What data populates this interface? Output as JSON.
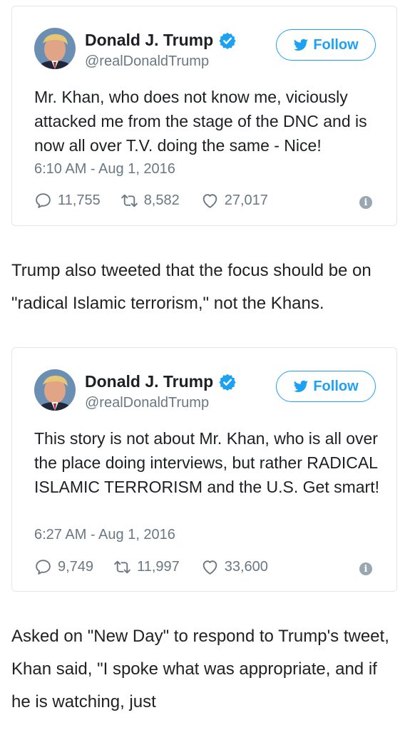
{
  "tweets": [
    {
      "name": "Donald J. Trump",
      "handle": "@realDonaldTrump",
      "follow_label": "Follow",
      "text": "Mr. Khan, who does not know me, viciously attacked me from the stage of the DNC and is now all over T.V. doing the same - Nice!",
      "time": "6:10 AM - Aug 1, 2016",
      "replies": "11,755",
      "retweets": "8,582",
      "likes": "27,017"
    },
    {
      "name": "Donald J. Trump",
      "handle": "@realDonaldTrump",
      "follow_label": "Follow",
      "text": "This story is not about Mr. Khan, who is all over the place doing interviews, but rather RADICAL ISLAMIC TERRORISM and the U.S. Get smart!",
      "time": "6:27 AM - Aug 1, 2016",
      "replies": "9,749",
      "retweets": "11,997",
      "likes": "33,600"
    }
  ],
  "article": {
    "para1": "Trump also tweeted that the focus should be on \"radical Islamic terrorism,\" not the Khans.",
    "para2": "Asked on \"New Day\" to respond to Trump's tweet, Khan said, \"I spoke what was appropriate, and if he is watching, just"
  },
  "colors": {
    "twitter_blue": "#1da1f2",
    "verified_blue": "#1da1f2",
    "muted": "#697882"
  },
  "icons": [
    "avatar",
    "verified-badge-icon",
    "twitter-bird-icon",
    "reply-icon",
    "retweet-icon",
    "like-icon",
    "info-icon"
  ]
}
